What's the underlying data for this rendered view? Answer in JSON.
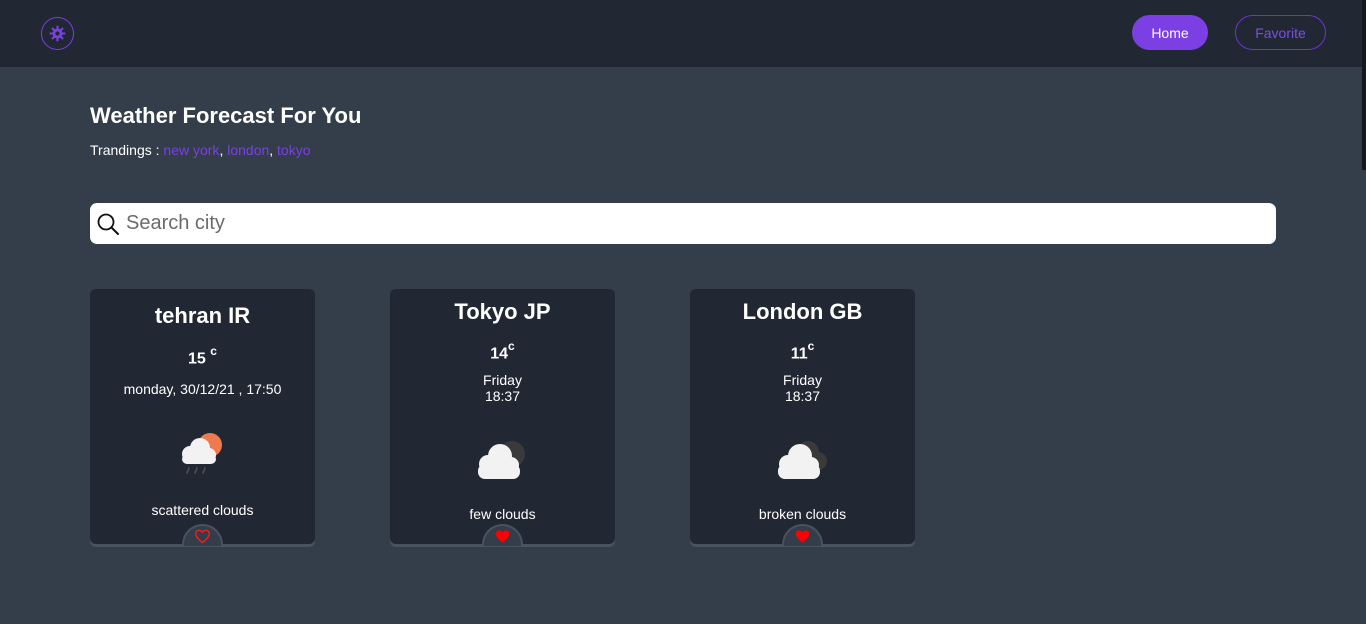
{
  "nav": {
    "theme_icon": "gear-icon",
    "home_label": "Home",
    "favorite_label": "Favorite"
  },
  "main": {
    "title": "Weather Forecast For You",
    "trending_label": "Trandings :",
    "trending": [
      "new york",
      "london",
      "tokyo"
    ],
    "separator": ","
  },
  "search": {
    "placeholder": "Search city",
    "value": ""
  },
  "cards": [
    {
      "city": "tehran IR",
      "temp": "15",
      "unit": "c",
      "date": "monday, 30/12/21 , 17:50",
      "time": "",
      "description": "scattered clouds",
      "icon": "cloud-sun-rain-icon",
      "favorite": false
    },
    {
      "city": "Tokyo JP",
      "temp": "14",
      "unit": "c",
      "date": "Friday",
      "time": "18:37",
      "description": "few clouds",
      "icon": "cloud-icon",
      "favorite": true
    },
    {
      "city": "London GB",
      "temp": "11",
      "unit": "c",
      "date": "Friday",
      "time": "18:37",
      "description": "broken clouds",
      "icon": "cloud-icon",
      "favorite": true
    }
  ],
  "colors": {
    "accent": "#7b3fe4",
    "background": "#343d4a",
    "card": "#212733",
    "heart": "#ff0000"
  }
}
